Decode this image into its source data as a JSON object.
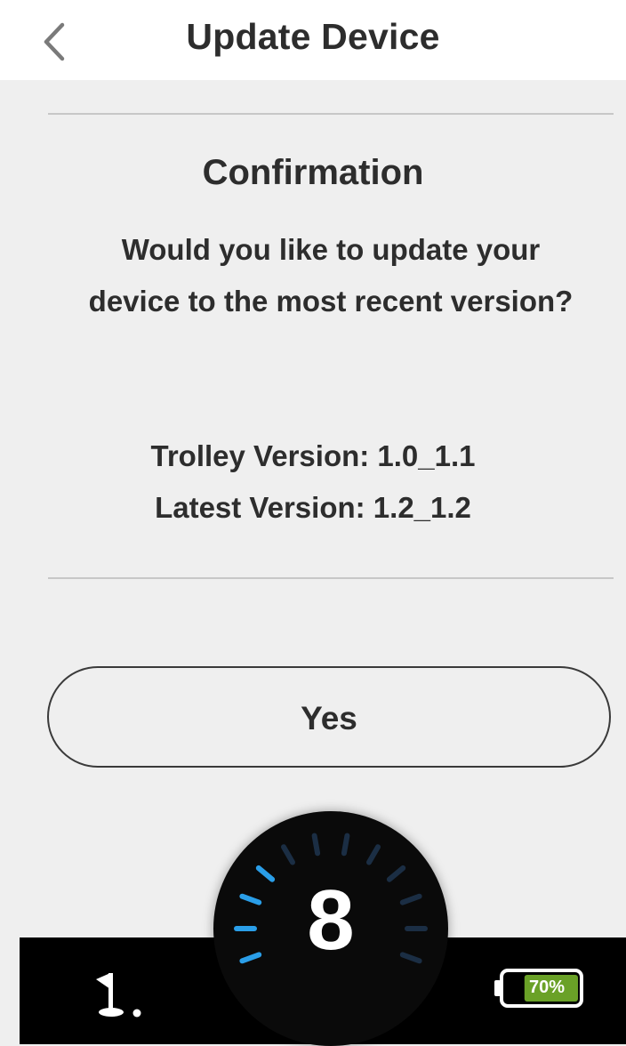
{
  "header": {
    "title": "Update Device",
    "back_icon": "chevron-left-icon"
  },
  "confirmation": {
    "title": "Confirmation",
    "question": "Would you like to update your device to the most recent version?",
    "trolley_version": "Trolley Version: 1.0_1.1",
    "latest_version": "Latest Version: 1.2_1.2"
  },
  "actions": {
    "yes_label": "Yes"
  },
  "dial": {
    "value": "8",
    "ticks_total": 12,
    "ticks_active": 4,
    "active_color": "#2a9ee8",
    "inactive_color": "#1b2e44"
  },
  "status_bar": {
    "flag_icon": "golf-flag-icon",
    "battery_label": "70%",
    "battery_level": 0.7,
    "battery_color": "#6aa127"
  }
}
